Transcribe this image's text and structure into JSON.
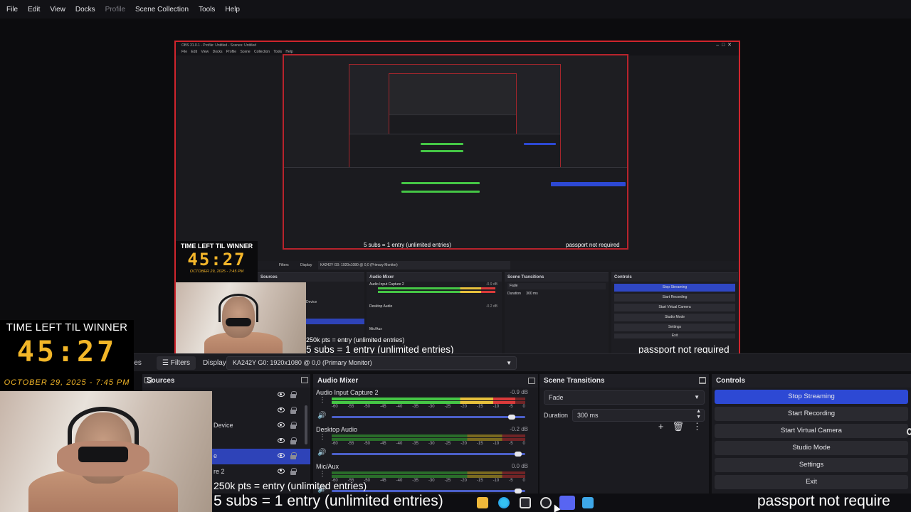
{
  "menubar": {
    "items": [
      "File",
      "Edit",
      "View",
      "Docks",
      "Profile",
      "Scene Collection",
      "Tools",
      "Help"
    ]
  },
  "preview": {
    "nested_title": "OBS 31.0.1 - Profile: Untitled - Scenes: Untitled",
    "menu_items": [
      "File",
      "Edit",
      "View",
      "Docks",
      "Profile",
      "Scene Collection",
      "Tools",
      "Help"
    ]
  },
  "inner_timer": {
    "title": "TIME LEFT TIL WINNER",
    "count": "45:27",
    "date": "OCTOBER 29, 2025 - 7:45 PM"
  },
  "inner_toolbar": {
    "filters": "Filters",
    "display": "Display",
    "monitor": "KA242Y G0: 1920x1080 @ 0,0 (Primary Monitor)"
  },
  "inner_docks": {
    "sources": "Sources",
    "mixer": "Audio Mixer",
    "transitions": "Scene Transitions",
    "controls": "Controls",
    "channels": [
      "Audio Input Capture 2",
      "Desktop Audio",
      "Mic/Aux"
    ],
    "dbs": [
      "-0.9 dB",
      "-0.2 dB"
    ],
    "transition": "Fade",
    "duration_label": "Duration",
    "duration_value": "300 ms",
    "source_device": "Device",
    "buttons": [
      "Stop Streaming",
      "Start Recording",
      "Start Virtual Camera",
      "Studio Mode",
      "Settings",
      "Exit"
    ]
  },
  "inner_captions": {
    "pts": "250k pts = entry (unlimited entries)",
    "subs": "5 subs = 1 entry (unlimited entries)",
    "passport": "passport not required"
  },
  "toolbar": {
    "properties": "rties",
    "filters": "Filters",
    "display_label": "Display",
    "display_value": "KA242Y G0: 1920x1080 @ 0,0 (Primary Monitor)"
  },
  "sources": {
    "title": "Sources",
    "rows": [
      {
        "label": ""
      },
      {
        "label": ""
      },
      {
        "label": "Device"
      },
      {
        "label": ""
      },
      {
        "label": "e",
        "selected": true
      },
      {
        "label": "re 2"
      }
    ]
  },
  "mixer": {
    "title": "Audio Mixer",
    "channels": [
      {
        "name": "Audio Input Capture 2",
        "db": "-0.9 dB",
        "level": 0.95,
        "volume": 0.95
      },
      {
        "name": "Desktop Audio",
        "db": "-0.2 dB",
        "level": 0.0,
        "volume": 0.98
      },
      {
        "name": "Mic/Aux",
        "db": "0.0 dB",
        "level": 0.0,
        "volume": 0.98
      }
    ],
    "scale": [
      "-60",
      "-55",
      "-50",
      "-45",
      "-40",
      "-35",
      "-30",
      "-25",
      "-20",
      "-15",
      "-10",
      "-5",
      "0"
    ]
  },
  "transitions": {
    "title": "Scene Transitions",
    "selected": "Fade",
    "duration_label": "Duration",
    "duration_value": "300 ms"
  },
  "controls": {
    "title": "Controls",
    "buttons": [
      "Stop Streaming",
      "Start Recording",
      "Start Virtual Camera",
      "Studio Mode",
      "Settings",
      "Exit"
    ]
  },
  "overlay": {
    "timer_title": "TIME LEFT TIL WINNER",
    "timer_count": "45:27",
    "timer_date": "OCTOBER 29, 2025 - 7:45 PM",
    "pts_text": "250k pts = entry (unlimited entries)",
    "subs_text": "5 subs = 1 entry (unlimited entries)",
    "passport_text": "passport not require"
  },
  "taskbar": {
    "icons": [
      "file-explorer-icon",
      "edge-icon",
      "store-icon",
      "obs-icon",
      "discord-icon",
      "notepad-icon"
    ]
  },
  "colors": {
    "accent": "#2d49d4",
    "preview_border": "#d0252d",
    "timer_gold": "#f2b628",
    "meter_green": "#45c645",
    "meter_yellow": "#e6c03c",
    "meter_red": "#d93a3a"
  }
}
